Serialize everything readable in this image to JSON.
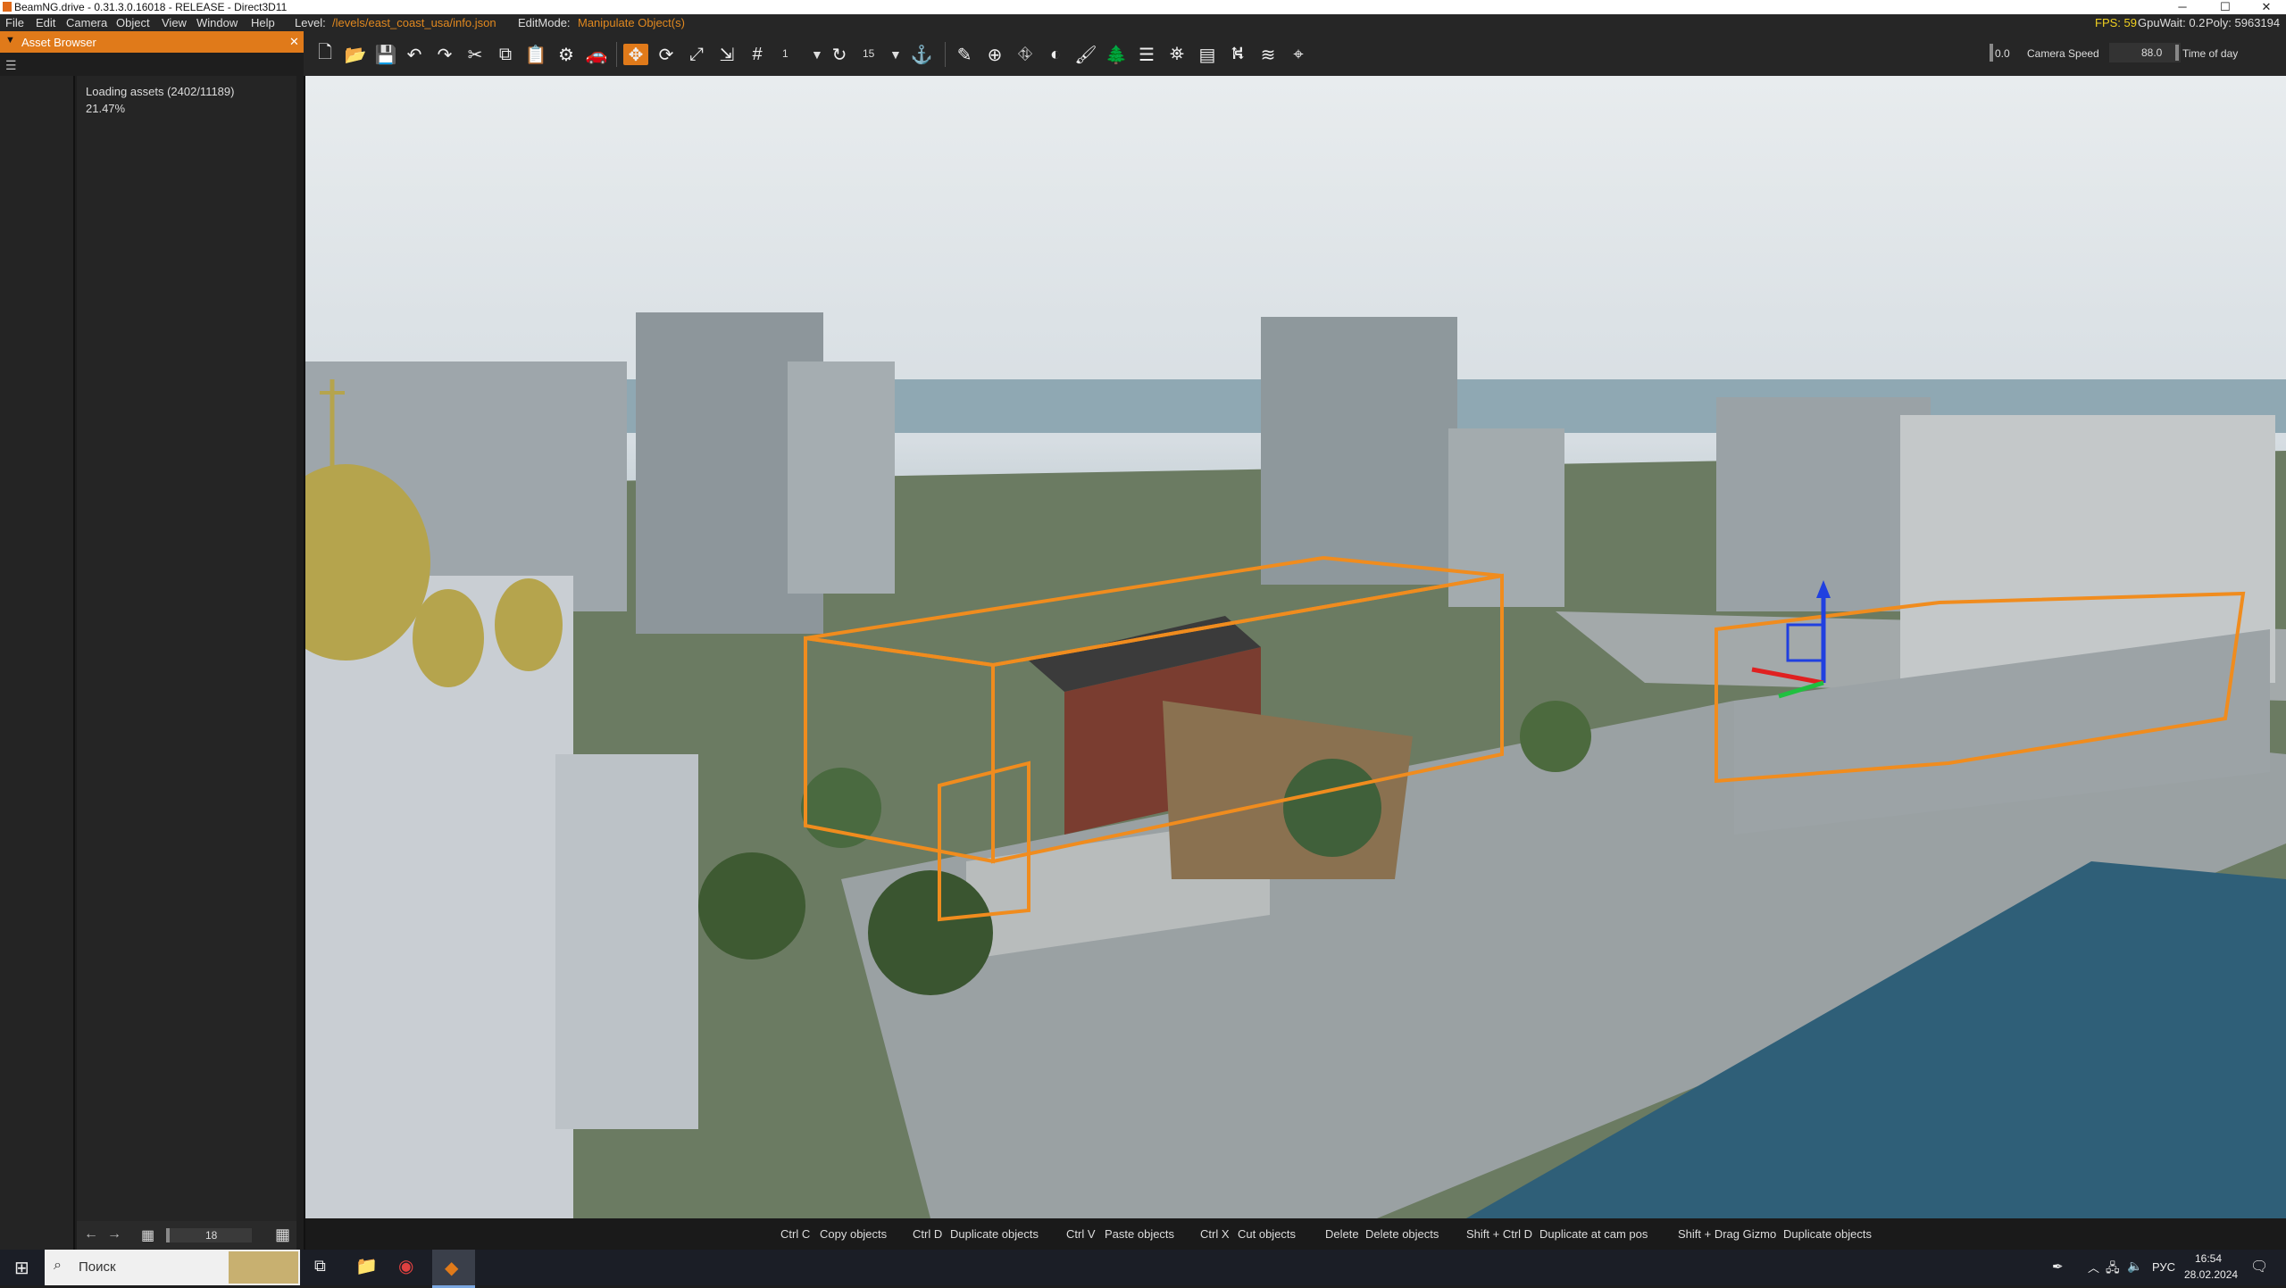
{
  "window": {
    "title": "BeamNG.drive - 0.31.3.0.16018 - RELEASE - Direct3D11",
    "minimize_glyph": "─",
    "maximize_glyph": "☐",
    "close_glyph": "✕"
  },
  "menu": {
    "items": [
      "File",
      "Edit",
      "Camera",
      "Object",
      "View",
      "Window",
      "Help"
    ],
    "level_label": "Level:",
    "level_value": "/levels/east_coast_usa/info.json",
    "editmode_label": "EditMode:",
    "editmode_value": "Manipulate Object(s)",
    "fps": "FPS: 59",
    "gpuwait": "GpuWait: 0.2",
    "poly": "Poly: 5963194"
  },
  "toolbar": {
    "snap_value": "1",
    "rotate_snap_value": "15",
    "camera_value": "0.0",
    "camera_speed_label": "Camera Speed",
    "camera_speed_value": "88.0",
    "time_of_day_label": "Time of day"
  },
  "asset_browser": {
    "title": "Asset Browser",
    "loading_text": "Loading assets (2402/11189)",
    "loading_percent": "21.47%",
    "thumb_size": "18"
  },
  "shortcuts": [
    {
      "key": "Ctrl C",
      "action": "Copy objects"
    },
    {
      "key": "Ctrl D",
      "action": "Duplicate objects"
    },
    {
      "key": "Ctrl V",
      "action": "Paste objects"
    },
    {
      "key": "Ctrl X",
      "action": "Cut objects"
    },
    {
      "key": "Delete",
      "action": "Delete objects"
    },
    {
      "key": "Shift + Ctrl D",
      "action": "Duplicate at cam pos"
    },
    {
      "key": "Shift + Drag Gizmo",
      "action": "Duplicate objects"
    }
  ],
  "taskbar": {
    "search_placeholder": "Поиск",
    "language": "РУС",
    "time": "16:54",
    "date": "28.02.2024"
  },
  "colors": {
    "accent": "#e07a1a",
    "selection": "#f08c1e",
    "gizmo_x": "#e02020",
    "gizmo_y": "#20c040",
    "gizmo_z": "#2040e0"
  }
}
